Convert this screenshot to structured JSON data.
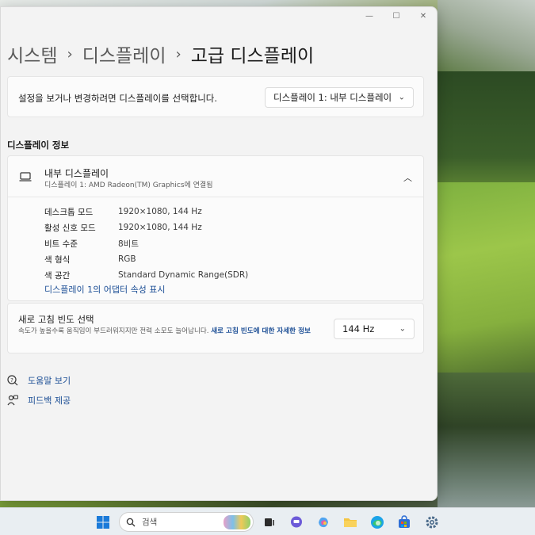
{
  "breadcrumb": {
    "item1": "시스템",
    "item2": "디스플레이",
    "current": "고급 디스플레이",
    "separator": "›"
  },
  "window_controls": {
    "minimize": "—",
    "maximize": "☐",
    "close": "✕"
  },
  "display_select": {
    "prompt": "설정을 보거나 변경하려면 디스플레이를 선택합니다.",
    "selected": "디스플레이 1: 내부 디스플레이"
  },
  "display_info": {
    "section_title": "디스플레이 정보",
    "name": "내부 디스플레이",
    "subtitle": "디스플레이 1: AMD Radeon(TM) Graphics에 연결됨",
    "rows": [
      {
        "label": "데스크톱 모드",
        "value": "1920×1080, 144 Hz"
      },
      {
        "label": "활성 신호 모드",
        "value": "1920×1080, 144 Hz"
      },
      {
        "label": "비트 수준",
        "value": "8비트"
      },
      {
        "label": "색 형식",
        "value": "RGB"
      },
      {
        "label": "색 공간",
        "value": "Standard Dynamic Range(SDR)"
      }
    ],
    "adapter_link": "디스플레이 1의 어댑터 속성 표시"
  },
  "refresh_rate": {
    "title": "새로 고침 빈도 선택",
    "description": "속도가 높을수록 움직임이 부드러워지지만 전력 소모도 늘어납니다. ",
    "link": "새로 고침 빈도에 대한 자세한 정보",
    "selected": "144 Hz"
  },
  "links": {
    "help": "도움말 보기",
    "feedback": "피드백 제공"
  },
  "taskbar": {
    "search_placeholder": "검색",
    "icons": [
      "windows-start-icon",
      "taskview-icon",
      "chat-icon",
      "copilot-icon",
      "file-explorer-icon",
      "edge-icon",
      "store-icon",
      "settings-icon"
    ]
  },
  "colors": {
    "accent_link": "#1d4f96",
    "window_bg": "#f3f3f3",
    "card_bg": "#fbfbfb"
  }
}
